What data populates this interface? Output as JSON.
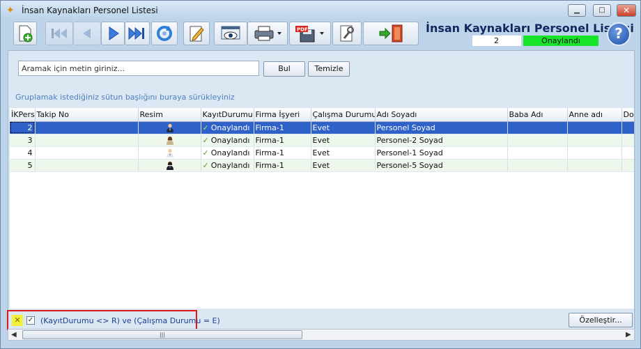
{
  "window": {
    "title": "İnsan Kaynakları Personel Listesi",
    "minimize": "▁",
    "maximize": "□",
    "close": "✕"
  },
  "header": {
    "title": "İnsan Kaynakları Personel Listesi",
    "count": "2",
    "status": "Onaylandı",
    "help": "?"
  },
  "toolbar": {
    "icons": [
      "new-icon",
      "first-record-icon",
      "previous-record-icon",
      "next-record-icon",
      "last-record-icon",
      "refresh-icon",
      "edit-icon",
      "preview-icon",
      "print-icon",
      "export-pdf-icon",
      "settings-icon",
      "exit-icon"
    ]
  },
  "search": {
    "placeholder": "Aramak için metin giriniz...",
    "find_label": "Bul",
    "clear_label": "Temizle"
  },
  "group_hint": "Gruplamak istediğiniz sütun başlığını buraya sürükleyiniz",
  "table": {
    "columns": [
      "İKPers",
      "Takip No",
      "Resim",
      "KayıtDurumu",
      "Firma İşyeri",
      "Çalışma Durumu",
      "Adı Soyadı",
      "Baba Adı",
      "Anne adı",
      "Doğ"
    ],
    "rows": [
      {
        "id": "2",
        "takip": "",
        "status": "Onaylandı",
        "firma": "Firma-1",
        "calisma": "Evet",
        "name": "Personel Soyad",
        "baba": "",
        "anne": ""
      },
      {
        "id": "3",
        "takip": "",
        "status": "Onaylandı",
        "firma": "Firma-1",
        "calisma": "Evet",
        "name": "Personel-2 Soyad",
        "baba": "",
        "anne": ""
      },
      {
        "id": "4",
        "takip": "",
        "status": "Onaylandı",
        "firma": "Firma-1",
        "calisma": "Evet",
        "name": "Personel-1 Soyad",
        "baba": "",
        "anne": ""
      },
      {
        "id": "5",
        "takip": "",
        "status": "Onaylandı",
        "firma": "Firma-1",
        "calisma": "Evet",
        "name": "Personel-5 Soyad",
        "baba": "",
        "anne": ""
      }
    ]
  },
  "filter": {
    "clear": "✕",
    "enabled": "✓",
    "expression": "(KayıtDurumu <> R) ve (Çalışma Durumu = E)",
    "customize_label": "Özelleştir..."
  },
  "scrollbar": {
    "left": "◀",
    "right": "▶",
    "grip": "|||"
  },
  "colors": {
    "status_green": "#18e52a",
    "selection": "#2f62c8",
    "filter_border": "#e01818",
    "title_blue": "#10285e"
  }
}
